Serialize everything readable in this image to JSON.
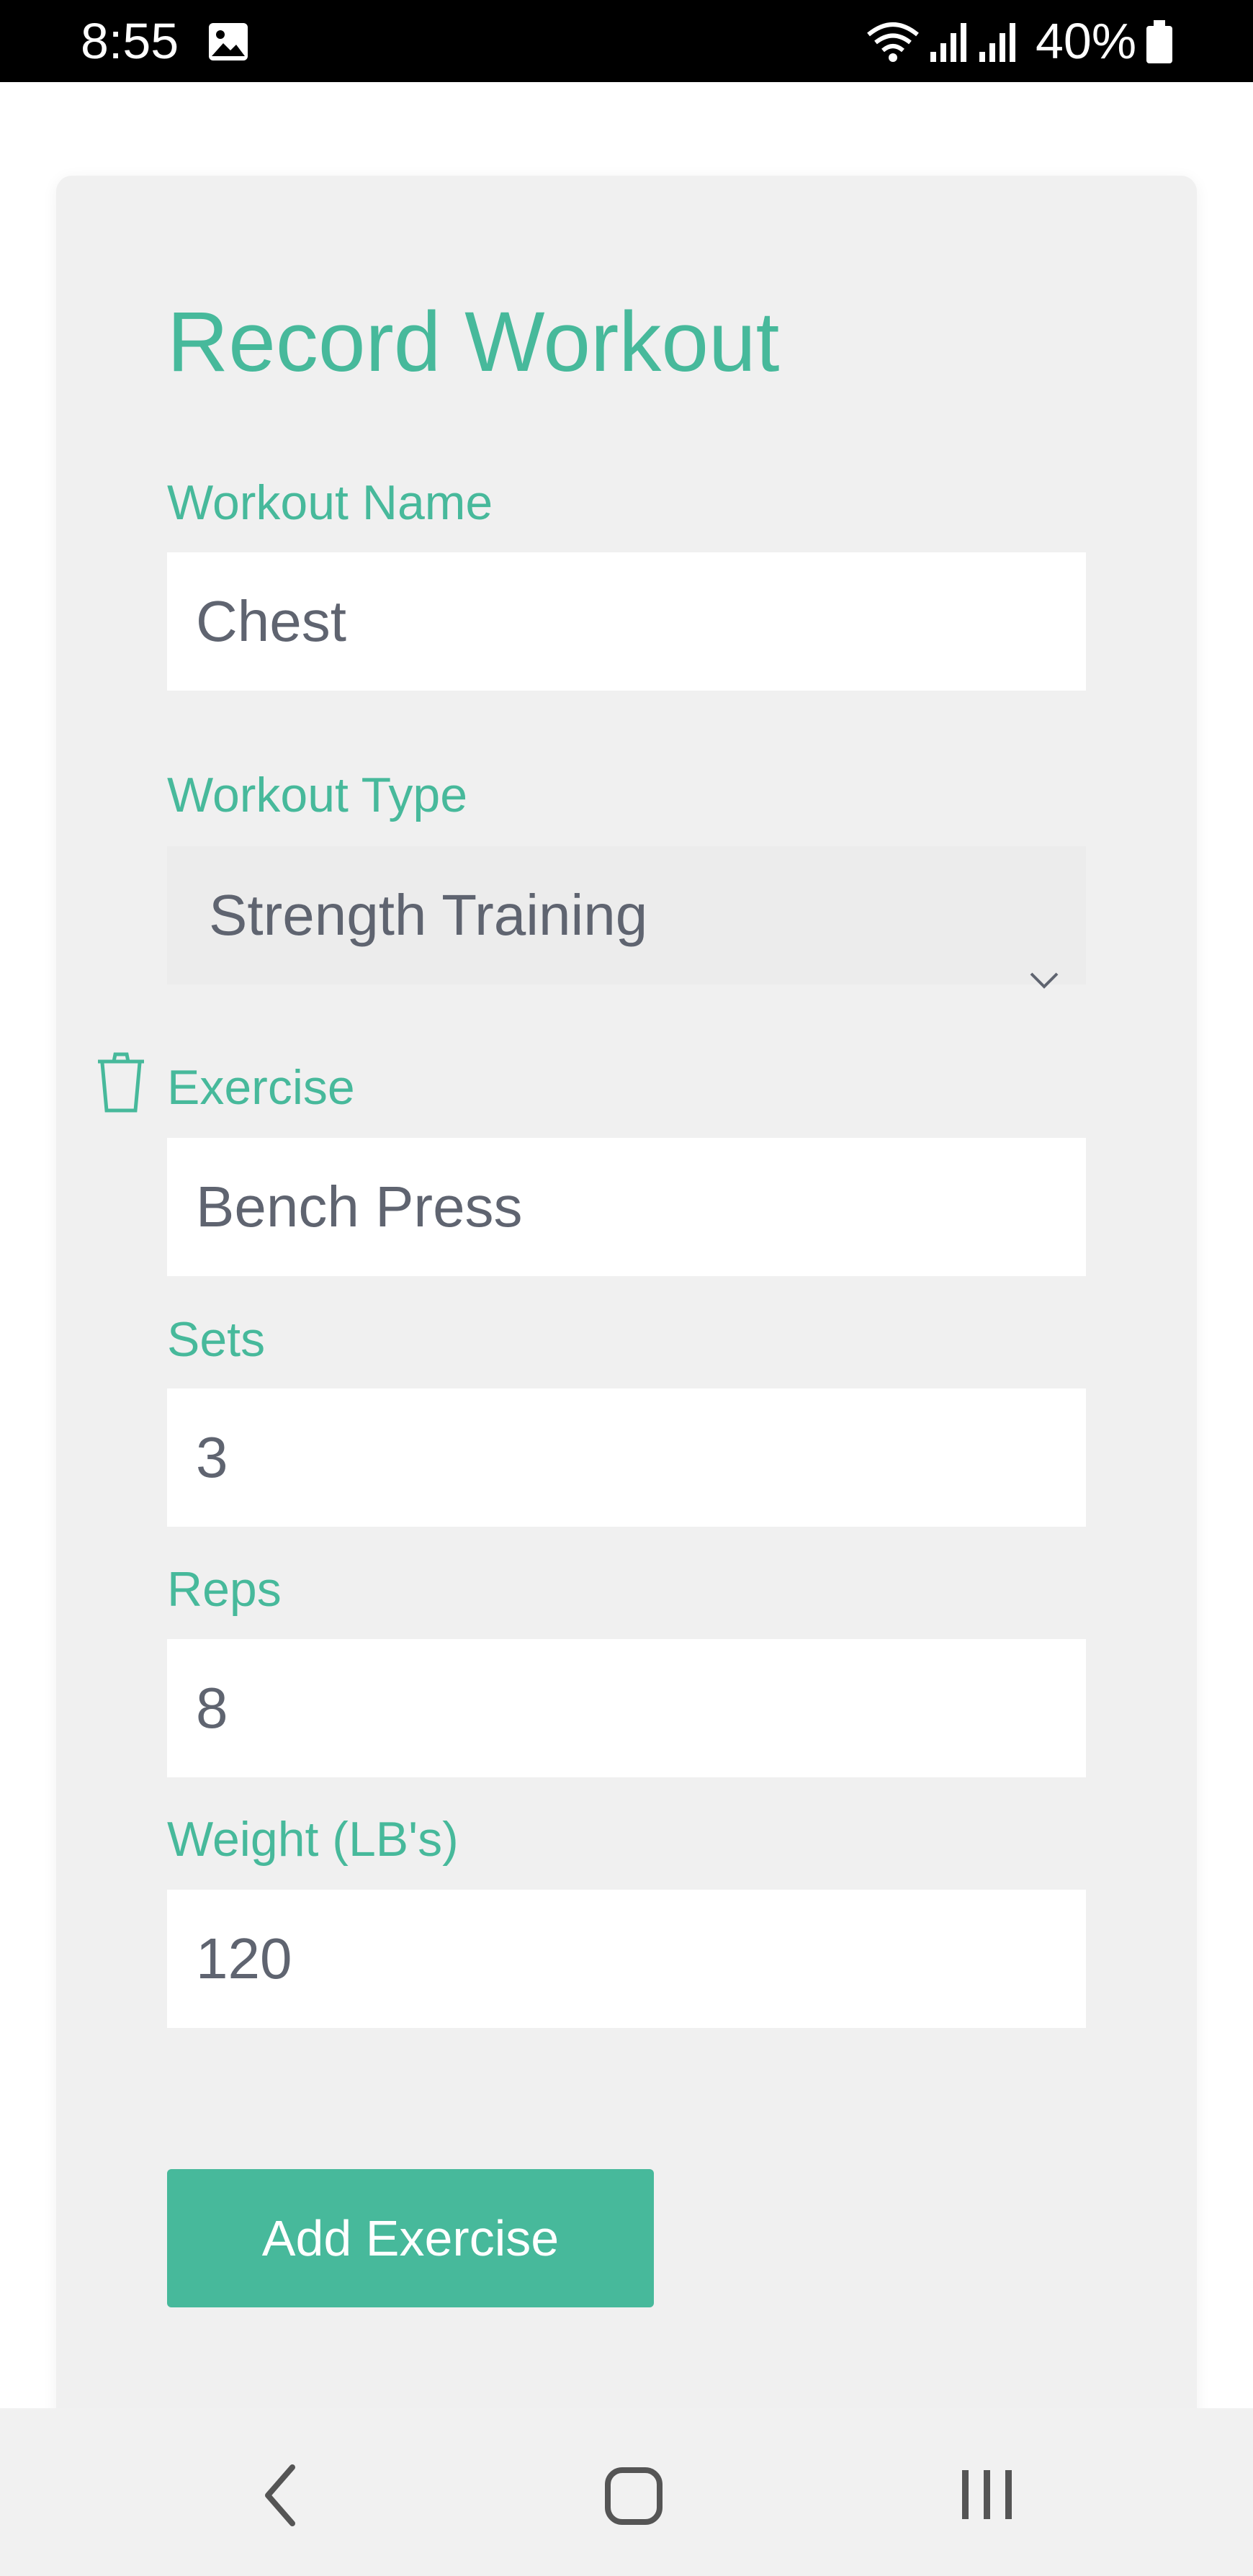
{
  "status_bar": {
    "time": "8:55",
    "battery_text": "40%",
    "icons": [
      "gallery-icon",
      "wifi-icon",
      "signal-icon",
      "signal-icon",
      "battery-icon"
    ]
  },
  "form": {
    "title": "Record Workout",
    "workout_name": {
      "label": "Workout Name",
      "value": "Chest"
    },
    "workout_type": {
      "label": "Workout Type",
      "value": "Strength Training"
    },
    "exercise": {
      "label": "Exercise",
      "value": "Bench Press"
    },
    "sets": {
      "label": "Sets",
      "value": "3"
    },
    "reps": {
      "label": "Reps",
      "value": "8"
    },
    "weight": {
      "label": "Weight (LB's)",
      "value": "120"
    },
    "add_button_label": "Add Exercise"
  },
  "nav_bar": {
    "icons": [
      "back-icon",
      "home-icon",
      "recents-icon"
    ]
  },
  "colors": {
    "accent": "#47b99b",
    "card_background": "#f0f0f0",
    "input_text": "#5f6470",
    "status_bar": "#000000"
  }
}
